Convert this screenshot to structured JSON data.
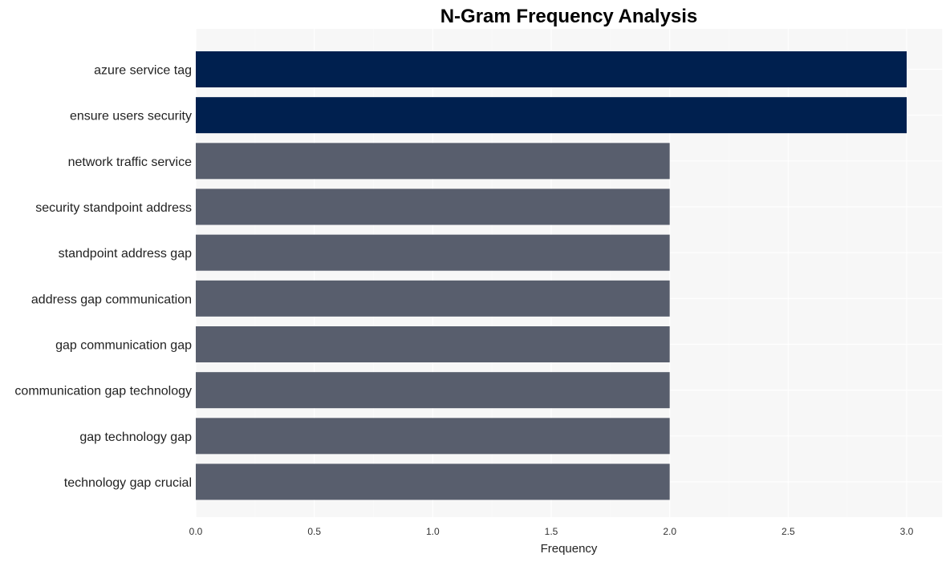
{
  "chart_data": {
    "type": "bar",
    "orientation": "horizontal",
    "title": "N-Gram Frequency Analysis",
    "xlabel": "Frequency",
    "ylabel": "",
    "xlim": [
      0,
      3.15
    ],
    "xticks": [
      0.0,
      0.5,
      1.0,
      1.5,
      2.0,
      2.5,
      3.0
    ],
    "xtick_labels": [
      "0.0",
      "0.5",
      "1.0",
      "1.5",
      "2.0",
      "2.5",
      "3.0"
    ],
    "grid": true,
    "legend": "none",
    "categories": [
      "azure service tag",
      "ensure users security",
      "network traffic service",
      "security standpoint address",
      "standpoint address gap",
      "address gap communication",
      "gap communication gap",
      "communication gap technology",
      "gap technology gap",
      "technology gap crucial"
    ],
    "values": [
      3,
      3,
      2,
      2,
      2,
      2,
      2,
      2,
      2,
      2
    ],
    "colors": {
      "highlight": "#00204f",
      "default": "#585e6d",
      "panel_background": "#f7f7f7",
      "grid": "#ffffff"
    }
  }
}
